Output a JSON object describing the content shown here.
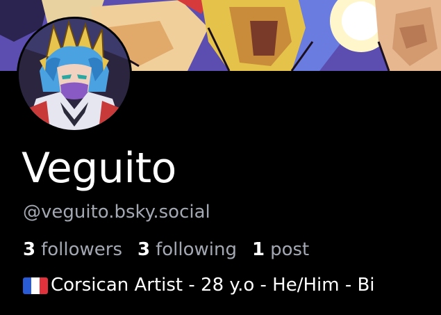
{
  "profile": {
    "display_name": "Veguito",
    "handle": "@veguito.bsky.social",
    "stats": {
      "followers_count": "3",
      "followers_label": "followers",
      "following_count": "3",
      "following_label": "following",
      "posts_count": "1",
      "posts_label": "post"
    },
    "bio": {
      "flag_icon": "france-flag-icon",
      "text": "Corsican Artist - 28 y.o - He/Him - Bi"
    }
  },
  "colors": {
    "background": "#000000",
    "primary_text": "#ffffff",
    "secondary_text": "#a3a8b3",
    "flag_blue": "#2a5bd7",
    "flag_white": "#ffffff",
    "flag_red": "#e0323c"
  }
}
